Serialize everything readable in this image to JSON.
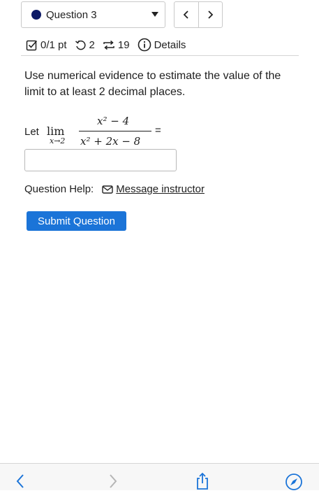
{
  "header": {
    "question_label": "Question 3",
    "prev_symbol": "<",
    "next_symbol": ">"
  },
  "meta": {
    "score": "0/1 pt",
    "retries": "2",
    "submissions": "19",
    "details": "Details"
  },
  "question": {
    "prompt": "Use numerical evidence to estimate the value of the limit to at least 2 decimal places.",
    "let": "Let",
    "lim": "lim",
    "lim_sub": "x→2",
    "numerator": "x² − 4",
    "denominator": "x² + 2x − 8",
    "equals": "=",
    "answer_value": ""
  },
  "help": {
    "label": "Question Help:",
    "message_link": "Message instructor"
  },
  "submit_label": "Submit Question",
  "colors": {
    "accent": "#1b74d8",
    "dot": "#0d1a66"
  },
  "browser_toolbar": {
    "icons": [
      "back-arrow-icon",
      "forward-arrow-icon",
      "share-icon",
      "compass-icon"
    ]
  }
}
